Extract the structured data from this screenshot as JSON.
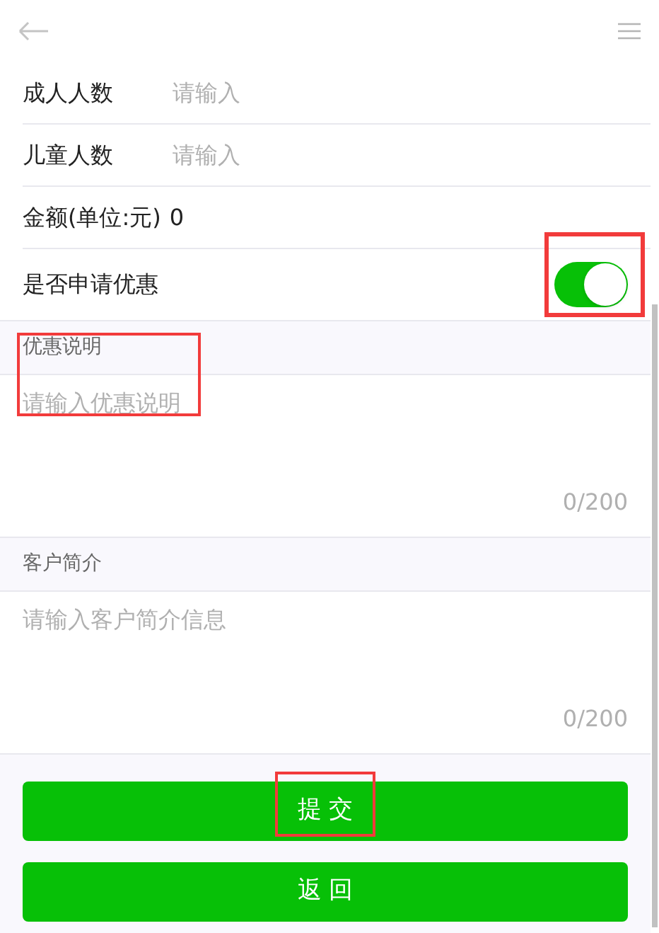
{
  "fields": [
    {
      "kind": "input",
      "label": "成人人数",
      "placeholder": "请输入"
    },
    {
      "kind": "input",
      "label": "儿童人数",
      "placeholder": "请输入"
    },
    {
      "kind": "text",
      "label": "金额(单位:元)",
      "value": "0"
    },
    {
      "kind": "switch",
      "label": "是否申请优惠",
      "on": true,
      "highlighted": true
    }
  ],
  "sections": [
    {
      "title": "优惠说明",
      "placeholder": "请输入优惠说明",
      "counter": "0/200",
      "highlighted": true
    },
    {
      "title": "客户简介",
      "placeholder": "请输入客户简介信息",
      "counter": "0/200",
      "highlighted": false
    }
  ],
  "buttons": [
    {
      "label": "提 交",
      "highlighted": true
    },
    {
      "label": "返 回",
      "highlighted": false
    }
  ]
}
